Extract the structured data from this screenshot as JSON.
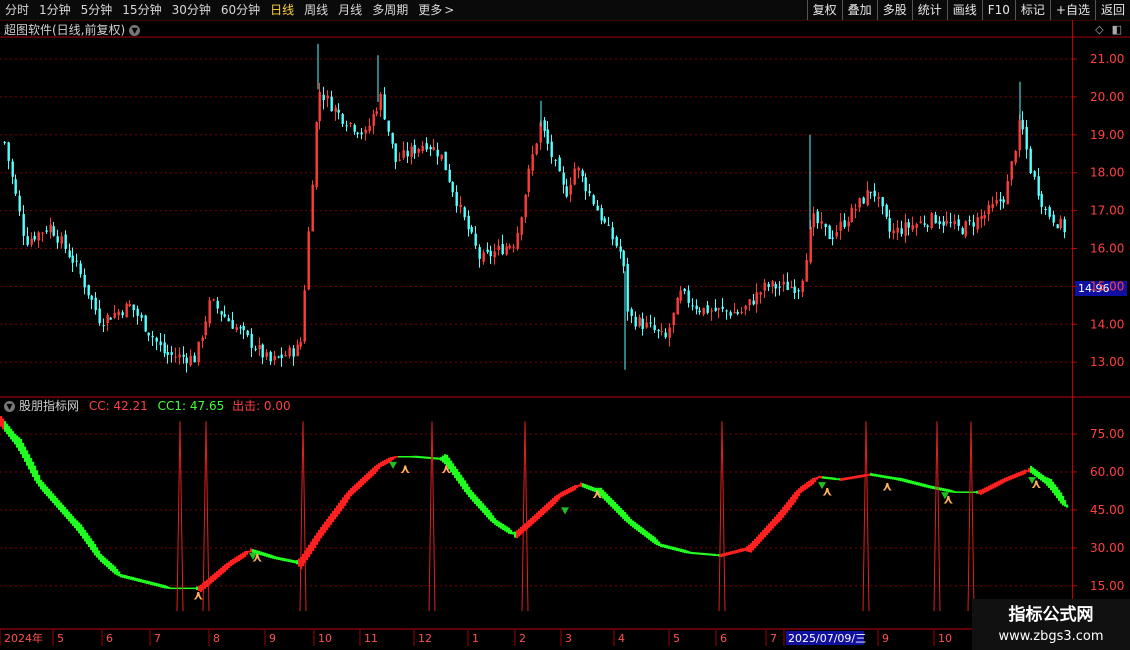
{
  "toolbar": {
    "tabs": [
      "分时",
      "1分钟",
      "5分钟",
      "15分钟",
      "30分钟",
      "60分钟",
      "日线",
      "周线",
      "月线",
      "多周期",
      "更多"
    ],
    "active_tab": "日线",
    "right_buttons": [
      "复权",
      "叠加",
      "多股",
      "统计",
      "画线",
      "F10",
      "标记",
      "+自选",
      "返回"
    ]
  },
  "price_panel": {
    "title": "超图软件(日线,前复权)",
    "y_ticks": [
      "21.00",
      "20.00",
      "19.00",
      "18.00",
      "17.00",
      "16.00",
      "15.00",
      "14.00",
      "13.00"
    ],
    "y_values": [
      21,
      20,
      19,
      18,
      17,
      16,
      15,
      14,
      13
    ],
    "current_price": "14.96",
    "current_price_value": 14.96,
    "up_color": "#ff3c3c",
    "down_color": "#54ffff",
    "grid_color": "#7a0000"
  },
  "indicator_panel": {
    "name": "股朋指标网",
    "cc_text": "CC: 42.21",
    "cc1_text": "CC1: 47.65",
    "out_text": "出击: 0.00",
    "y_ticks": [
      "75.00",
      "60.00",
      "45.00",
      "30.00",
      "15.00"
    ],
    "y_values": [
      75,
      60,
      45,
      30,
      15
    ],
    "rise_color": "#ff2020",
    "fall_color": "#20ff20",
    "signal_color": "#e02020"
  },
  "x_axis": {
    "labels": [
      "2024年",
      "5",
      "6",
      "7",
      "8",
      "9",
      "10",
      "11",
      "12",
      "1",
      "2",
      "3",
      "4",
      "5",
      "6",
      "7",
      "2025/07/09/三",
      "9",
      "10"
    ],
    "highlight_label": "2025/07/09/三"
  },
  "watermark": {
    "line1": "指标公式网",
    "line2": "www.zbgs3.com"
  }
}
